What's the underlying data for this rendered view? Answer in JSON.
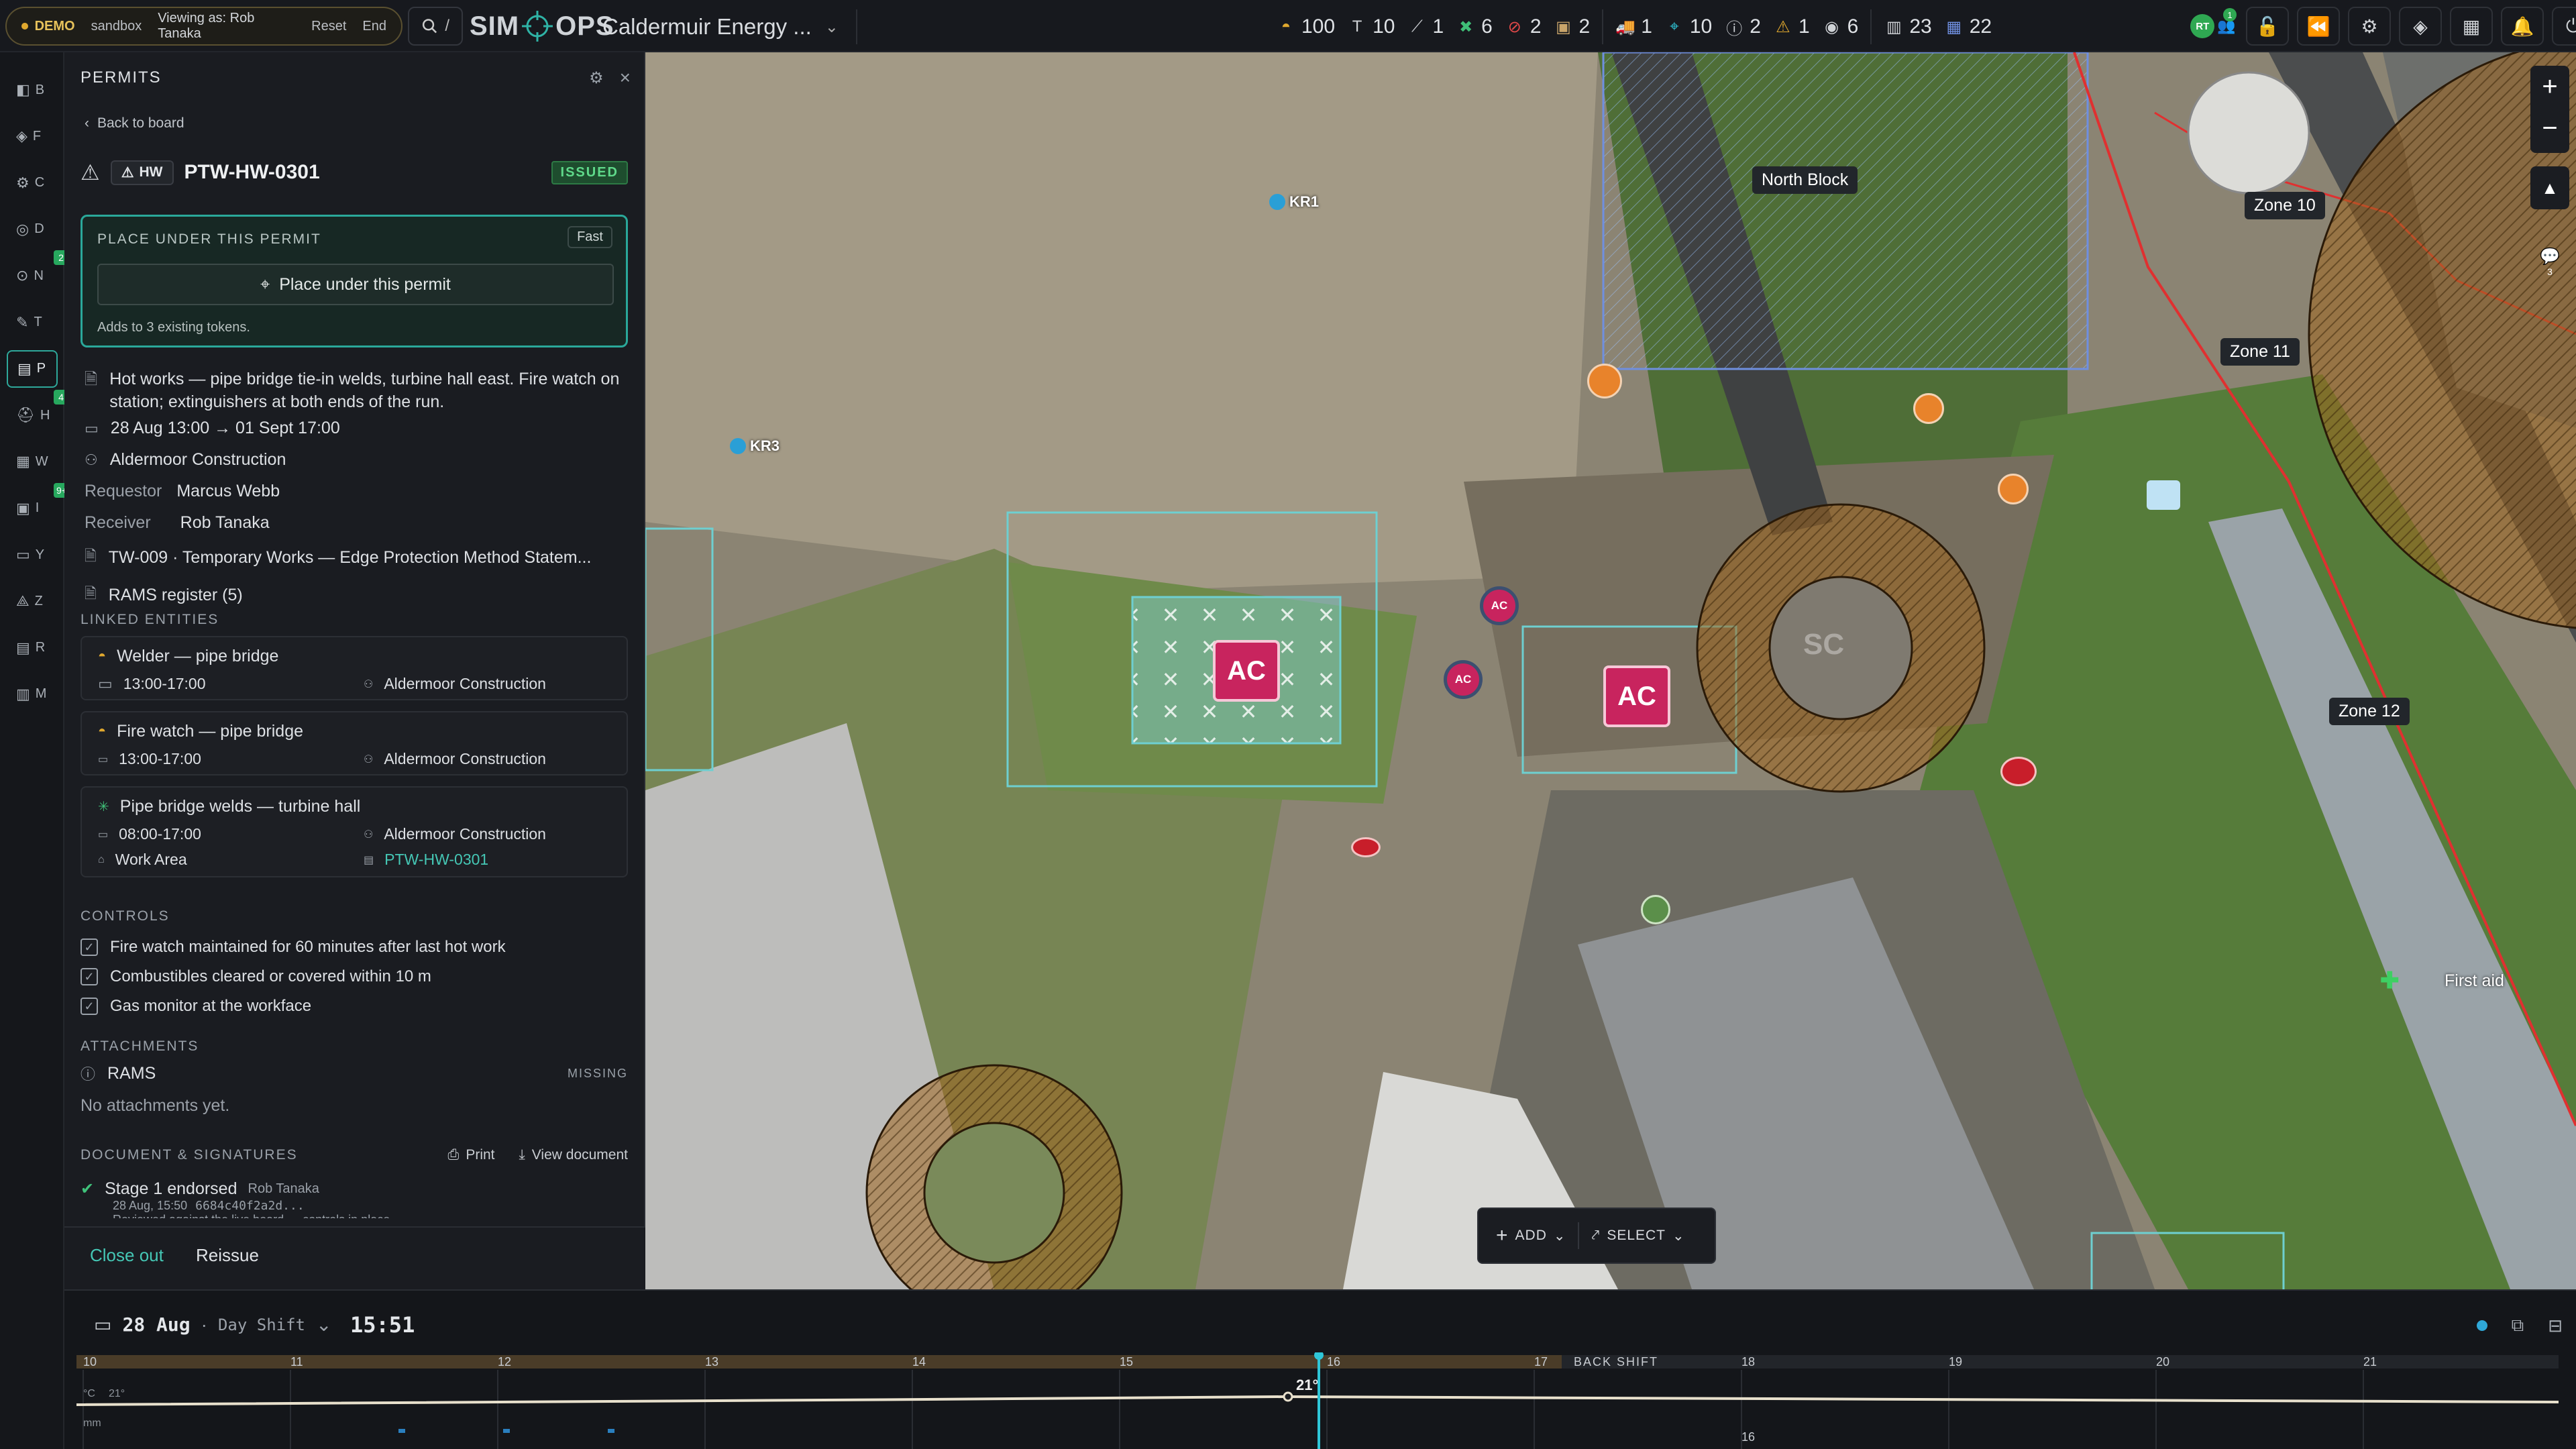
{
  "topbar": {
    "demo_label": "DEMO",
    "env": "sandbox",
    "viewing_as": "Viewing as: Rob Tanaka",
    "reset": "Reset",
    "end": "End",
    "search_shortcut": "/",
    "logo_left": "SIM",
    "logo_right": "OPS",
    "project": "Caldermuir Energy ...",
    "stats": [
      {
        "icon": "hardhat-icon",
        "value": "100"
      },
      {
        "icon": "crane-icon",
        "value": "10"
      },
      {
        "icon": "excavator-icon",
        "value": "1"
      },
      {
        "icon": "no-go-green-icon",
        "value": "6"
      },
      {
        "icon": "prohibited-icon",
        "value": "2"
      },
      {
        "icon": "material-icon",
        "value": "2"
      },
      {
        "icon": "vehicle-icon",
        "value": "1"
      },
      {
        "icon": "location-pin-icon",
        "value": "10"
      },
      {
        "icon": "alert-circle-icon",
        "value": "2"
      },
      {
        "icon": "warning-icon",
        "value": "1"
      },
      {
        "icon": "eye-icon",
        "value": "6"
      },
      {
        "icon": "building-icon",
        "value": "23"
      },
      {
        "icon": "grid-icon",
        "value": "22"
      }
    ],
    "avatar_initials": "RT",
    "notif_count": "1"
  },
  "rail": {
    "items": [
      {
        "key": "B"
      },
      {
        "key": "F"
      },
      {
        "key": "C"
      },
      {
        "key": "D"
      },
      {
        "key": "N",
        "badge": "2"
      },
      {
        "key": "T"
      },
      {
        "key": "P",
        "active": true
      },
      {
        "key": "H",
        "badge": "4"
      },
      {
        "key": "W"
      },
      {
        "key": "I",
        "badge": "9+"
      },
      {
        "key": "Y"
      },
      {
        "key": "Z"
      },
      {
        "key": "R"
      },
      {
        "key": "M"
      }
    ]
  },
  "panel": {
    "title": "PERMITS",
    "back": "Back to board",
    "type_badge": "HW",
    "permit_id": "PTW-HW-0301",
    "status": "ISSUED",
    "place_title": "PLACE UNDER THIS PERMIT",
    "fast": "Fast",
    "place_button": "Place under this permit",
    "place_note": "Adds to 3 existing tokens.",
    "description": "Hot works — pipe bridge tie-in welds, turbine hall east. Fire watch on station; extinguishers at both ends of the run.",
    "dates": "28 Aug 13:00 → 01 Sept 17:00",
    "contractor": "Aldermoor Construction",
    "requestor_label": "Requestor",
    "requestor": "Marcus Webb",
    "receiver_label": "Receiver",
    "receiver": "Rob Tanaka",
    "tw_ref": "TW-009 · Temporary Works — Edge Protection Method Statem...",
    "rams": "RAMS register (5)",
    "linked_title": "LINKED ENTITIES",
    "linked": [
      {
        "name": "Welder — pipe bridge",
        "time": "13:00-17:00",
        "org": "Aldermoor Construction"
      },
      {
        "name": "Fire watch — pipe bridge",
        "time": "13:00-17:00",
        "org": "Aldermoor Construction"
      },
      {
        "name": "Pipe bridge welds — turbine hall",
        "time": "08:00-17:00",
        "org": "Aldermoor Construction",
        "kind": "Work Area",
        "ref": "PTW-HW-0301"
      }
    ],
    "controls_title": "CONTROLS",
    "controls": [
      "Fire watch maintained for 60 minutes after last hot work",
      "Combustibles cleared or covered within 10 m",
      "Gas monitor at the workface"
    ],
    "attachments_title": "ATTACHMENTS",
    "attach_name": "RAMS",
    "attach_status": "MISSING",
    "no_attach": "No attachments yet.",
    "doc_title": "DOCUMENT & SIGNATURES",
    "print": "Print",
    "view_doc": "View document",
    "stage": "Stage 1 endorsed",
    "stage_by": "Rob Tanaka",
    "stage_time": "28 Aug, 15:50",
    "stage_hash": "6684c40f2a2d...",
    "stage_note": "Reviewed against the live board — controls in place",
    "close_out": "Close out",
    "reissue": "Reissue"
  },
  "map": {
    "labels": {
      "north_block": "North Block",
      "zone10": "Zone 10",
      "zone11": "Zone 11",
      "zone12": "Zone 12",
      "first_aid": "First aid",
      "kr1": "KR1",
      "kr3": "KR3",
      "ac": "AC",
      "sc": "SC"
    },
    "add": "ADD",
    "select": "SELECT",
    "comments_count": "3"
  },
  "timeline": {
    "date": "28 Aug",
    "shift": "Day Shift",
    "time": "15:51",
    "back_shift": "BACK SHIFT",
    "hours": [
      "10",
      "11",
      "12",
      "13",
      "14",
      "15",
      "16",
      "17",
      "18",
      "19",
      "20",
      "21"
    ],
    "temp_unit": "°C",
    "temp_small": "21°",
    "temp_peak": "21°",
    "rain_unit": "mm",
    "wind_value": "16"
  }
}
